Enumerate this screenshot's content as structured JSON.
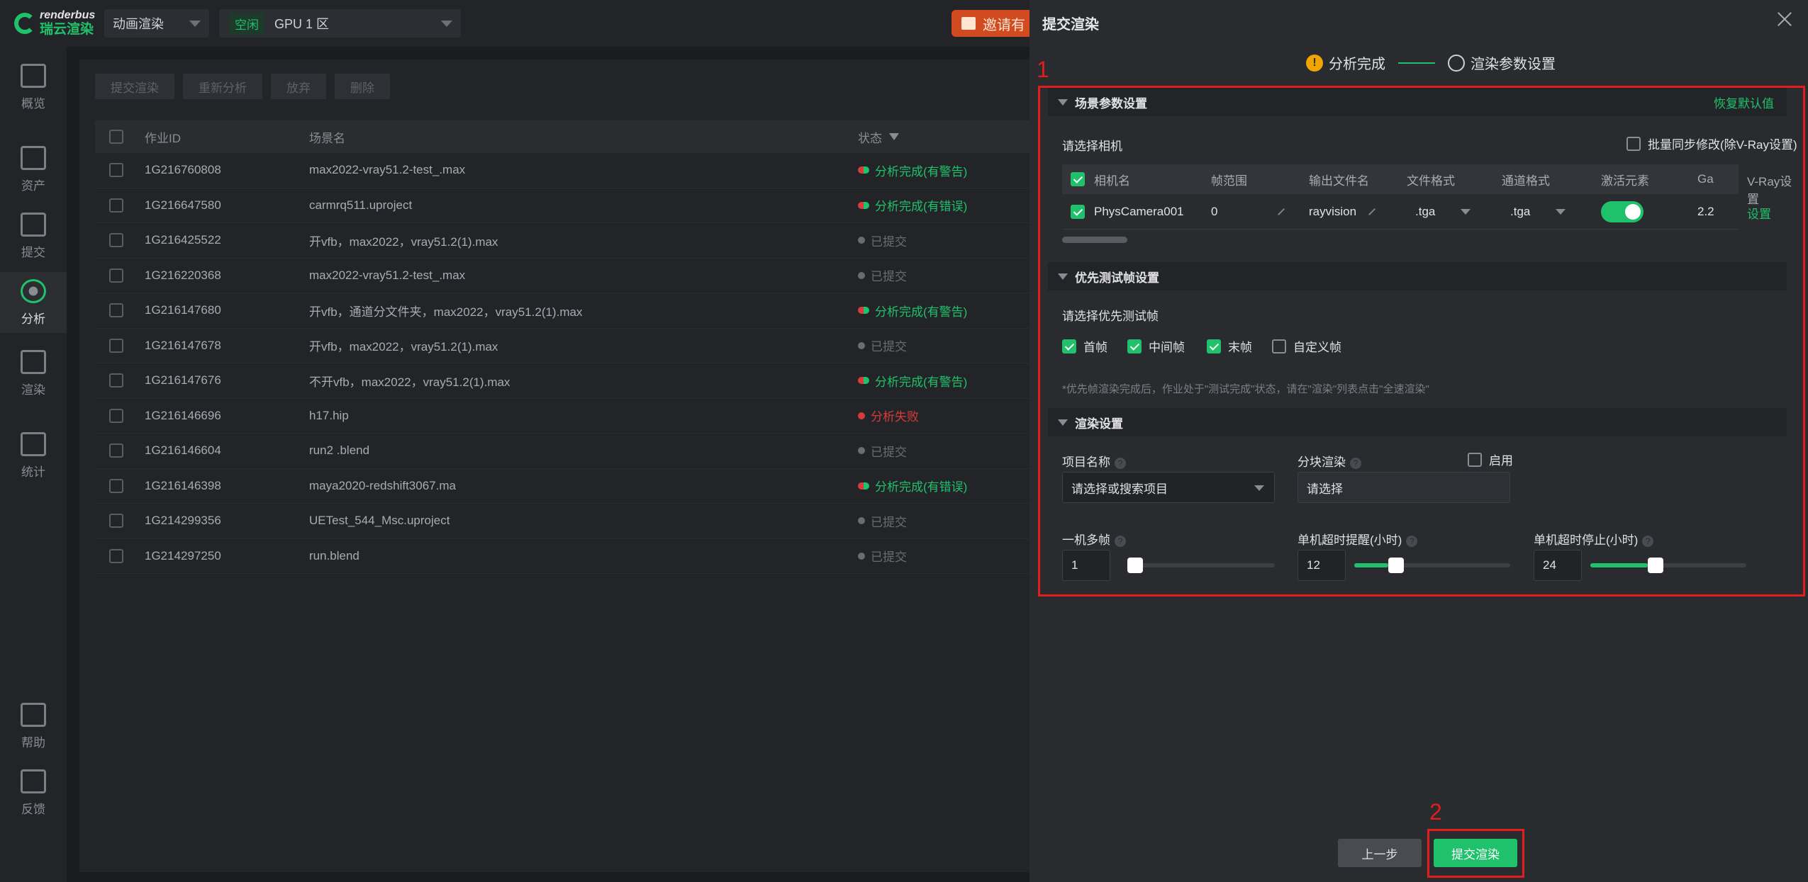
{
  "topbar": {
    "logo_en": "renderbus",
    "logo_cn": "瑞云渲染",
    "mode_select": "动画渲染",
    "gpu_status": "空闲",
    "gpu_select": "GPU 1 区",
    "invite_label": "邀请有"
  },
  "sidenav": {
    "items": [
      {
        "label": "概览",
        "icon": "overview-icon"
      },
      {
        "label": "资产",
        "icon": "assets-icon"
      },
      {
        "label": "提交",
        "icon": "upload-icon"
      },
      {
        "label": "分析",
        "icon": "analysis-icon"
      },
      {
        "label": "渲染",
        "icon": "render-icon"
      },
      {
        "label": "统计",
        "icon": "stats-icon"
      },
      {
        "label": "帮助",
        "icon": "help-icon"
      },
      {
        "label": "反馈",
        "icon": "feedback-icon"
      }
    ]
  },
  "toolbar": {
    "submit": "提交渲染",
    "reanalyze": "重新分析",
    "abandon": "放弃",
    "delete": "删除"
  },
  "jobs": {
    "headers": {
      "id": "作业ID",
      "scene": "场景名",
      "status": "状态"
    },
    "rows": [
      {
        "id": "1G216760808",
        "scene": "max2022-vray51.2-test_.max",
        "status": "分析完成(有警告)",
        "kind": "warn"
      },
      {
        "id": "1G216647580",
        "scene": "carmrq511.uproject",
        "status": "分析完成(有错误)",
        "kind": "warn"
      },
      {
        "id": "1G216425522",
        "scene": "开vfb，max2022，vray51.2(1).max",
        "status": "已提交",
        "kind": "sub"
      },
      {
        "id": "1G216220368",
        "scene": "max2022-vray51.2-test_.max",
        "status": "已提交",
        "kind": "sub"
      },
      {
        "id": "1G216147680",
        "scene": "开vfb，通道分文件夹，max2022，vray51.2(1).max",
        "status": "分析完成(有警告)",
        "kind": "warn"
      },
      {
        "id": "1G216147678",
        "scene": "开vfb，max2022，vray51.2(1).max",
        "status": "已提交",
        "kind": "sub"
      },
      {
        "id": "1G216147676",
        "scene": "不开vfb，max2022，vray51.2(1).max",
        "status": "分析完成(有警告)",
        "kind": "warn"
      },
      {
        "id": "1G216146696",
        "scene": "h17.hip",
        "status": "分析失败",
        "kind": "fail"
      },
      {
        "id": "1G216146604",
        "scene": "run2 .blend",
        "status": "已提交",
        "kind": "sub"
      },
      {
        "id": "1G216146398",
        "scene": "maya2020-redshift3067.ma",
        "status": "分析完成(有错误)",
        "kind": "warn"
      },
      {
        "id": "1G214299356",
        "scene": "UETest_544_Msc.uproject",
        "status": "已提交",
        "kind": "sub"
      },
      {
        "id": "1G214297250",
        "scene": "run.blend",
        "status": "已提交",
        "kind": "sub"
      }
    ]
  },
  "panel": {
    "title": "提交渲染",
    "step1": "分析完成",
    "step2": "渲染参数设置",
    "annotation1": "1",
    "annotation2": "2",
    "scene_section": "场景参数设置",
    "restore_default": "恢复默认值",
    "choose_camera": "请选择相机",
    "batch_sync": "批量同步修改(除V-Ray设置)",
    "cam_headers": {
      "name": "相机名",
      "frames": "帧范围",
      "output": "输出文件名",
      "format": "文件格式",
      "channel": "通道格式",
      "activate": "激活元素",
      "gamma": "Ga",
      "vray": "V-Ray设置"
    },
    "camera": {
      "name": "PhysCamera001",
      "frames": "0",
      "output": "rayvision",
      "format": ".tga",
      "channel": ".tga",
      "gamma": "2.2",
      "vray": "设置"
    },
    "priority_section": "优先测试帧设置",
    "choose_priority": "请选择优先测试帧",
    "frames": {
      "first": "首帧",
      "middle": "中间帧",
      "last": "末帧",
      "custom": "自定义帧"
    },
    "priority_hint": "*优先帧渲染完成后，作业处于\"测试完成\"状态，请在\"渲染\"列表点击\"全速渲染\"",
    "render_section": "渲染设置",
    "project_name": "项目名称",
    "project_placeholder": "请选择或搜索项目",
    "tile_render": "分块渲染",
    "tile_enable": "启用",
    "tile_placeholder": "请选择",
    "multi_frame": "一机多帧",
    "multi_frame_value": "1",
    "timeout_warn": "单机超时提醒(小时)",
    "timeout_warn_value": "12",
    "timeout_stop": "单机超时停止(小时)",
    "timeout_stop_value": "24",
    "sliders": {
      "multi_frame": 0.0,
      "timeout_warn": 0.22,
      "timeout_stop": 0.37
    },
    "prev_button": "上一步",
    "submit_button": "提交渲染"
  }
}
